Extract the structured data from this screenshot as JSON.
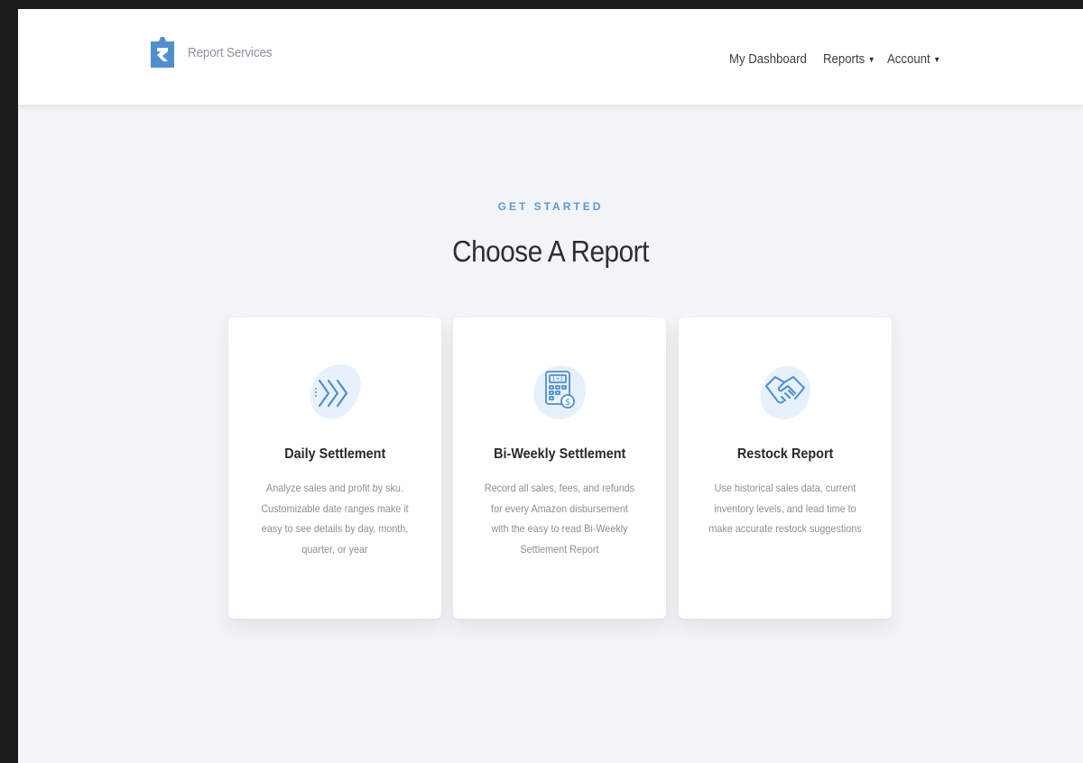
{
  "brand": {
    "name": "Report Services",
    "logo_icon": "report-services-logo-icon"
  },
  "nav": {
    "dashboard_label": "My Dashboard",
    "reports_label": "Reports",
    "account_label": "Account",
    "caret_icon": "caret-down-icon"
  },
  "hero": {
    "eyebrow": "GET STARTED",
    "title": "Choose A Report"
  },
  "cards": [
    {
      "icon": "chevrons-right-icon",
      "title": "Daily Settlement",
      "description": "Analyze sales and profit by sku. Customizable date ranges make it easy to see details by day, month, quarter, or year"
    },
    {
      "icon": "calculator-dollar-icon",
      "title": "Bi-Weekly Settlement",
      "description": "Record all sales, fees, and refunds for every Amazon disbursement with the easy to read Bi-Weekly Settlement Report"
    },
    {
      "icon": "handshake-icon",
      "title": "Restock Report",
      "description": "Use historical sales data, current inventory levels, and lead time to make accurate restock suggestions"
    }
  ],
  "colors": {
    "accent": "#5b9bd5",
    "brand_blue": "#4f8fd0",
    "icon_bg": "#e7f1fb",
    "page_bg": "#f2f4f7"
  }
}
